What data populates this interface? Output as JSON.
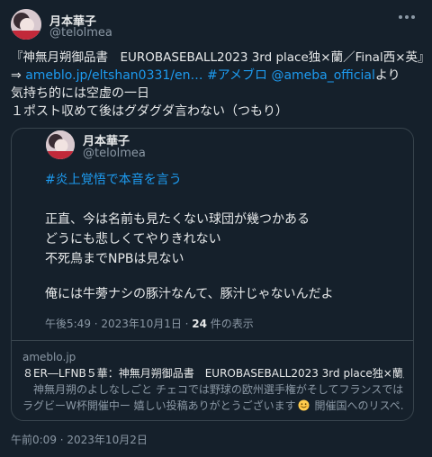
{
  "post": {
    "author_name": "月本華子",
    "author_handle": "@telolmea",
    "lines": {
      "l1": "『神無月朔御品書　EUROBASEBALL2023 3rd place独×蘭／Final西×英』",
      "l2_prefix": "⇒ ",
      "l2_link1": "ameblo.jp/eltshan0331/en…",
      "l2_space": " ",
      "l2_hashtag": "#アメブロ",
      "l2_space2": " ",
      "l2_mention": "@ameba_official",
      "l2_suffix": "より",
      "l3": "気持ち的には空虚の一日",
      "l4": "１ポスト収めて後はグダグダ言わない（つもり）"
    },
    "timestamp": "午前0:09 · 2023年10月2日"
  },
  "quote": {
    "author_name": "月本華子",
    "author_handle": "@telolmea",
    "hashtag": "#炎上覚悟で本音を言う",
    "lines": [
      "正直、今は名前も見たくない球団が幾つかある",
      "どうにも悲しくてやりきれない",
      "不死鳥までNPBは見ない",
      "俺には牛蒡ナシの豚汁なんて、豚汁じゃないんだよ"
    ],
    "meta_time": "午後5:49 · 2023年10月1日 · ",
    "meta_count": "24",
    "meta_suffix": " 件の表示"
  },
  "link_card": {
    "domain": "ameblo.jp",
    "title": "８ER―LFNB５華：神無月朔御品書　EUROBASEBALL2023 3rd place独×蘭／Fin…",
    "desc1": "　神無月朔のよしなしごと チェコでは野球の欧州選手権がそしてフランスでは",
    "desc2a": "ラグビーW杯開催中ー 嬉しい投稿ありがとうございます",
    "desc2b": " 開催国へのリスペ…"
  },
  "more_icon": "more-horizontal-icon",
  "colors": {
    "background": "#15202b",
    "text": "#e7e9ea",
    "muted": "#8b98a5",
    "link": "#1d9bf0",
    "hashtag": "#1d9bf0",
    "border": "#38444d"
  }
}
